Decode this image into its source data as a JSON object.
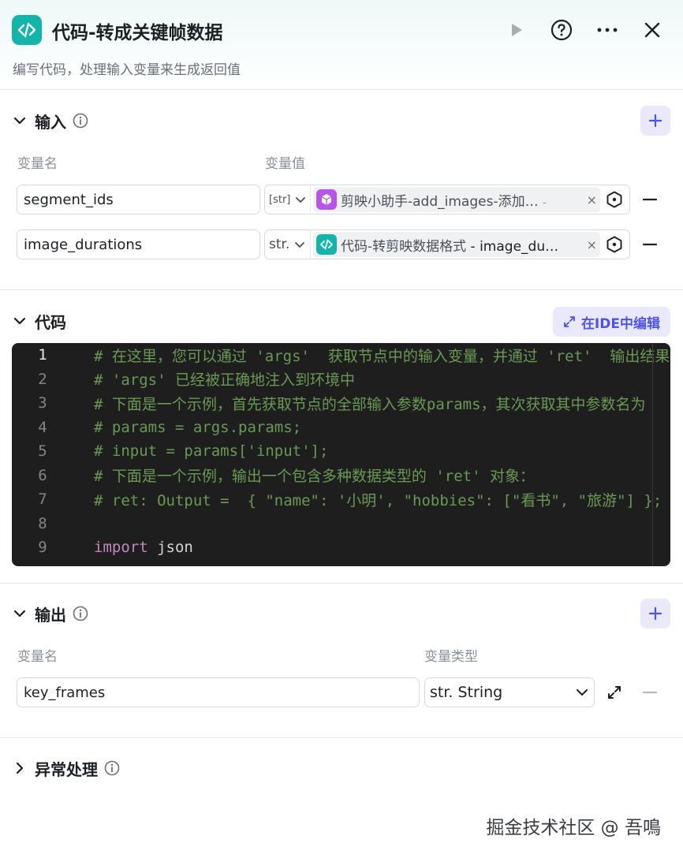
{
  "header": {
    "title": "代码-转成关键帧数据",
    "subtitle": "编写代码，处理输入变量来生成返回值",
    "accent_color": "#13b5ab"
  },
  "input_section": {
    "title": "输入",
    "col_name": "变量名",
    "col_value": "变量值",
    "rows": [
      {
        "name": "segment_ids",
        "type": "[str]",
        "ref_node": "剪映小助手-add_images-添加…",
        "ref_var": "-",
        "ref_icon_color": "#b655e6"
      },
      {
        "name": "image_durations",
        "type": "str.",
        "ref_node": "代码-转剪映数据格式",
        "ref_var": "- image_du…",
        "ref_icon_color": "#13b5ab"
      }
    ]
  },
  "code_section": {
    "title": "代码",
    "ide_button": "在IDE中编辑",
    "lines": [
      {
        "num": "1",
        "text": "# 在这里，您可以通过 'args'  获取节点中的输入变量，并通过 'ret'  输出结果"
      },
      {
        "num": "2",
        "text": "# 'args' 已经被正确地注入到环境中"
      },
      {
        "num": "3",
        "text": "# 下面是一个示例，首先获取节点的全部输入参数params，其次获取其中参数名为"
      },
      {
        "num": "4",
        "text": "# params = args.params;"
      },
      {
        "num": "5",
        "text": "# input = params['input'];"
      },
      {
        "num": "6",
        "text": "# 下面是一个示例，输出一个包含多种数据类型的 'ret' 对象："
      },
      {
        "num": "7",
        "text": "# ret: Output =  { \"name\": '小明', \"hobbies\": [\"看书\", \"旅游\"] };"
      },
      {
        "num": "8",
        "text": ""
      },
      {
        "num": "9",
        "kw": "import",
        "plain": " json"
      }
    ]
  },
  "output_section": {
    "title": "输出",
    "col_name": "变量名",
    "col_type": "变量类型",
    "rows": [
      {
        "name": "key_frames",
        "type": "str. String"
      }
    ]
  },
  "error_section": {
    "title": "异常处理"
  },
  "watermark": "掘金技术社区 @ 吾鳴"
}
